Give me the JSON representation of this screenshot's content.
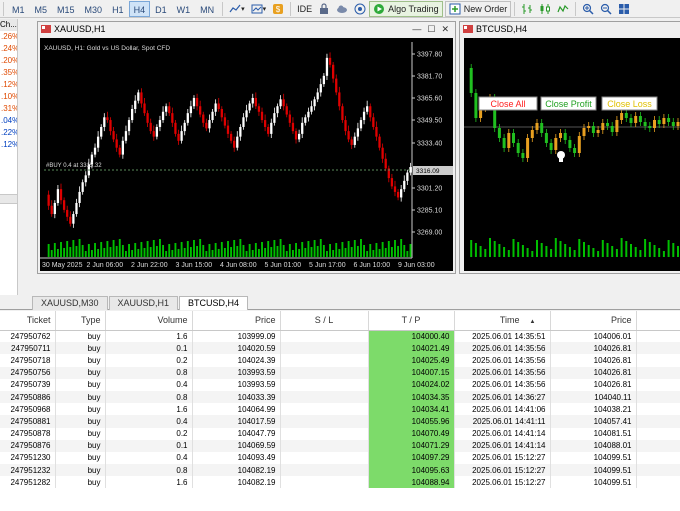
{
  "toolbar": {
    "timeframes": [
      "M1",
      "M5",
      "M15",
      "M30",
      "H1",
      "H4",
      "D1",
      "W1",
      "MN"
    ],
    "active_timeframe": "H4",
    "ide_label": "IDE",
    "algo_trading_label": "Algo Trading",
    "new_order_label": "New Order"
  },
  "left_panel": {
    "header": "Ch...",
    "rows": [
      ".26%",
      ".24%",
      ".20%",
      ".35%",
      ".12%",
      ".10%",
      ".31%",
      ".04%",
      ".22%",
      ".12%"
    ]
  },
  "xau_window": {
    "title": "XAUUSD,H1",
    "chart_title": "XAUUSD, H1:  Gold vs US Dollar, Spot CFD",
    "trade_line_label": "#BUY 0.4 at 3315.32",
    "current_price": "3316.09",
    "price_ticks": [
      "3397.80",
      "3381.70",
      "3365.60",
      "3349.50",
      "3333.40",
      "3316.09",
      "3301.20",
      "3285.10",
      "3269.00"
    ],
    "time_ticks": [
      "30 May 2025",
      "2 Jun 06:00",
      "2 Jun 22:00",
      "3 Jun 15:00",
      "4 Jun 08:00",
      "5 Jun 01:00",
      "5 Jun 17:00",
      "6 Jun 10:00",
      "9 Jun 03:00"
    ]
  },
  "btc_window": {
    "title": "BTCUSD,H4",
    "buttons": {
      "close_all": "Close All",
      "close_profit": "Close Profit",
      "close_loss": "Close Loss"
    }
  },
  "tabs": [
    "XAUUSD,M30",
    "XAUUSD,H1",
    "BTCUSD,H4"
  ],
  "active_tab": "BTCUSD,H4",
  "table": {
    "columns": [
      "Ticket",
      "Type",
      "Volume",
      "Price",
      "S / L",
      "T / P",
      "Time",
      "Price"
    ],
    "sort_indicator": "▲",
    "rows": [
      [
        "247950762",
        "buy",
        "1.6",
        "103999.09",
        "",
        "104000.40",
        "2025.06.01 14:35:51",
        "104006.01"
      ],
      [
        "247950711",
        "buy",
        "0.1",
        "104020.59",
        "",
        "104021.49",
        "2025.06.01 14:35:56",
        "104026.81"
      ],
      [
        "247950718",
        "buy",
        "0.2",
        "104024.39",
        "",
        "104025.49",
        "2025.06.01 14:35:56",
        "104026.81"
      ],
      [
        "247950756",
        "buy",
        "0.8",
        "103993.59",
        "",
        "104007.15",
        "2025.06.01 14:35:56",
        "104026.81"
      ],
      [
        "247950739",
        "buy",
        "0.4",
        "103993.59",
        "",
        "104024.02",
        "2025.06.01 14:35:56",
        "104026.81"
      ],
      [
        "247950886",
        "buy",
        "0.8",
        "104033.39",
        "",
        "104034.35",
        "2025.06.01 14:36:27",
        "104040.11"
      ],
      [
        "247950968",
        "buy",
        "1.6",
        "104064.99",
        "",
        "104034.41",
        "2025.06.01 14:41:06",
        "104038.21"
      ],
      [
        "247950881",
        "buy",
        "0.4",
        "104017.59",
        "",
        "104055.96",
        "2025.06.01 14:41:11",
        "104057.41"
      ],
      [
        "247950878",
        "buy",
        "0.2",
        "104047.79",
        "",
        "104070.49",
        "2025.06.01 14:41:14",
        "104081.51"
      ],
      [
        "247950876",
        "buy",
        "0.1",
        "104069.59",
        "",
        "104071.29",
        "2025.06.01 14:41:14",
        "104088.01"
      ],
      [
        "247951230",
        "buy",
        "0.4",
        "104093.49",
        "",
        "104097.29",
        "2025.06.01 15:12:27",
        "104099.51"
      ],
      [
        "247951232",
        "buy",
        "0.8",
        "104082.19",
        "",
        "104095.63",
        "2025.06.01 15:12:27",
        "104099.51"
      ],
      [
        "247951282",
        "buy",
        "1.6",
        "104082.19",
        "",
        "104088.94",
        "2025.06.01 15:12:27",
        "104099.51"
      ]
    ]
  },
  "colors": {
    "bull_candle": "#ffffff",
    "bear_candle": "#e00000",
    "volume": "#00c000",
    "tp_cell": "#7ddb6a",
    "close_all_text": "#ff2020",
    "close_profit_text": "#20a020",
    "close_loss_text": "#e0c000"
  }
}
